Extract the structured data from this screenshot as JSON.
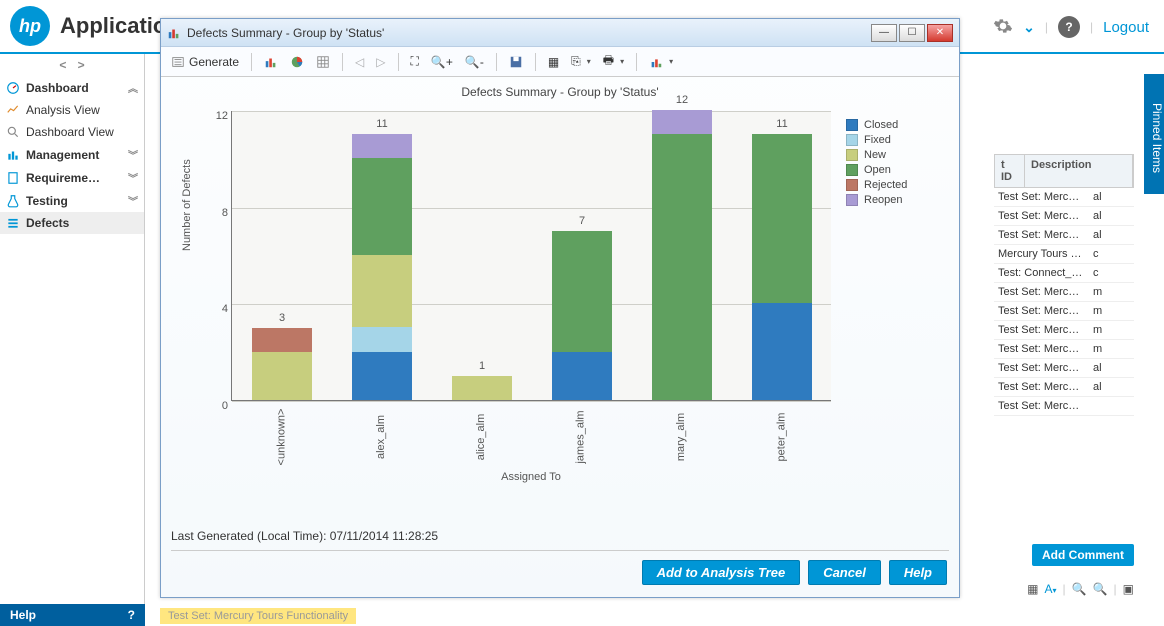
{
  "app_title": "Applicatio",
  "topbar": {
    "logout": "Logout"
  },
  "sidebar": {
    "sections": [
      {
        "label": "Dashboard",
        "children": [
          {
            "label": "Analysis View"
          },
          {
            "label": "Dashboard View"
          }
        ]
      },
      {
        "label": "Management"
      },
      {
        "label": "Requireme…"
      },
      {
        "label": "Testing"
      },
      {
        "label": "Defects"
      }
    ],
    "help": "Help"
  },
  "pinned_label": "Pinned Items",
  "right_table": {
    "headers": [
      "t ID",
      "Description"
    ],
    "rows": [
      [
        "Test Set: Mercur…",
        "al"
      ],
      [
        "Test Set: Mercur…",
        "al"
      ],
      [
        "Test Set: Mercur…",
        "al"
      ],
      [
        "Mercury Tours si…",
        "c"
      ],
      [
        "Test: Connect_Si…",
        "c"
      ],
      [
        "Test Set: Mercur…",
        "m"
      ],
      [
        "Test Set: Mercur…",
        "m"
      ],
      [
        "Test Set: Mercur…",
        "m"
      ],
      [
        "Test Set: Mercur…",
        "m"
      ],
      [
        "Test Set: Mercur…",
        "al"
      ],
      [
        "Test Set: Mercur…",
        "al"
      ],
      [
        "Test Set: Mercur…",
        ""
      ]
    ],
    "add_comment": "Add Comment"
  },
  "yellow_strip": "Test Set: Mercury Tours Functionality",
  "dialog": {
    "title": "Defects Summary - Group by 'Status'",
    "generate": "Generate",
    "buttons": {
      "add": "Add to Analysis Tree",
      "cancel": "Cancel",
      "help": "Help"
    },
    "last_generated": "Last Generated (Local Time): 07/11/2014 11:28:25"
  },
  "chart_data": {
    "type": "bar",
    "title": "Defects Summary - Group by 'Status'",
    "xlabel": "Assigned To",
    "ylabel": "Number of Defects",
    "ylim": [
      0,
      12
    ],
    "yticks": [
      0,
      4,
      8,
      12
    ],
    "categories": [
      "<unknown>",
      "alex_alm",
      "alice_alm",
      "james_alm",
      "mary_alm",
      "peter_alm"
    ],
    "series": [
      {
        "name": "Closed",
        "color": "#2f7bbf",
        "values": [
          0,
          2,
          0,
          2,
          0,
          4
        ]
      },
      {
        "name": "Fixed",
        "color": "#a5d5e8",
        "values": [
          0,
          1,
          0,
          0,
          0,
          0
        ]
      },
      {
        "name": "New",
        "color": "#c7ce7e",
        "values": [
          2,
          3,
          1,
          0,
          0,
          0
        ]
      },
      {
        "name": "Open",
        "color": "#5fa05f",
        "values": [
          0,
          4,
          0,
          5,
          11,
          7
        ]
      },
      {
        "name": "Rejected",
        "color": "#bc7765",
        "values": [
          1,
          0,
          0,
          0,
          0,
          0
        ]
      },
      {
        "name": "Reopen",
        "color": "#a89bd4",
        "values": [
          0,
          1,
          0,
          0,
          1,
          0
        ]
      }
    ],
    "totals": [
      3,
      11,
      1,
      7,
      12,
      11
    ]
  }
}
